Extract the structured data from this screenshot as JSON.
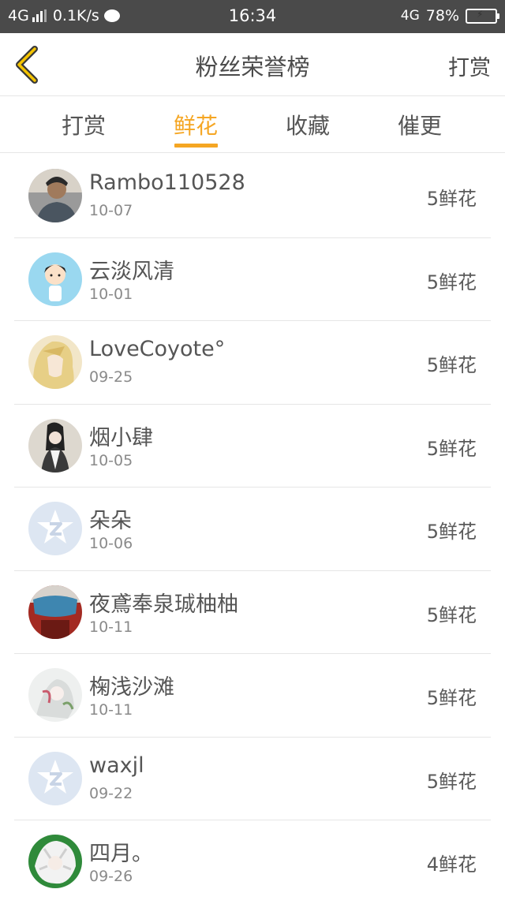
{
  "status_bar": {
    "network": "4G",
    "speed": "0.1K/s",
    "time": "16:34",
    "network_right": "4G",
    "battery": "78%"
  },
  "navbar": {
    "title": "粉丝荣誉榜",
    "action": "打赏"
  },
  "tabs": [
    {
      "label": "打赏",
      "active": false
    },
    {
      "label": "鲜花",
      "active": true
    },
    {
      "label": "收藏",
      "active": false
    },
    {
      "label": "催更",
      "active": false
    }
  ],
  "accent_color": "#f5a623",
  "fans": [
    {
      "name": "Rambo110528",
      "date": "10-07",
      "count": "5鲜花",
      "avatar": "photo"
    },
    {
      "name": "云淡风清",
      "date": "10-01",
      "count": "5鲜花",
      "avatar": "cartoon-boy"
    },
    {
      "name": "LoveCoyote°",
      "date": "09-25",
      "count": "5鲜花",
      "avatar": "anime-blonde"
    },
    {
      "name": "烟小肆",
      "date": "10-05",
      "count": "5鲜花",
      "avatar": "ink-portrait"
    },
    {
      "name": "朵朵",
      "date": "10-06",
      "count": "5鲜花",
      "avatar": "default-star"
    },
    {
      "name": "夜鳶奉泉珹柚柚",
      "date": "10-11",
      "count": "5鲜花",
      "avatar": "red-blue-scene"
    },
    {
      "name": "椈浅沙滩",
      "date": "10-11",
      "count": "5鲜花",
      "avatar": "anime-white"
    },
    {
      "name": "waxjl",
      "date": "09-22",
      "count": "5鲜花",
      "avatar": "default-star"
    },
    {
      "name": "四月。",
      "date": "09-26",
      "count": "4鲜花",
      "avatar": "anime-green"
    }
  ]
}
